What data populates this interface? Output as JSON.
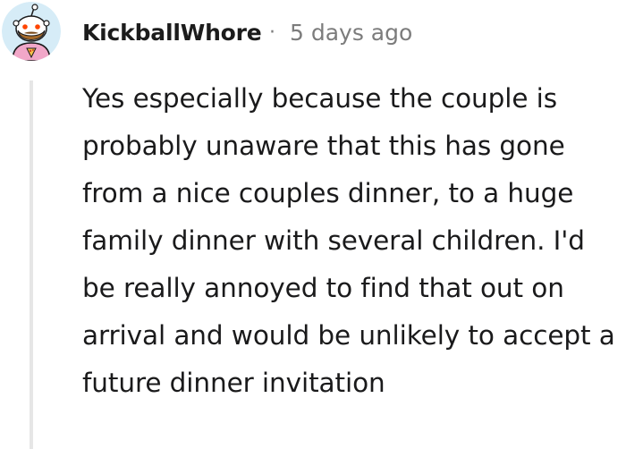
{
  "comment": {
    "avatar_icon": "snoo-avatar-icon",
    "username": "KickballWhore",
    "separator": "·",
    "timestamp": "5 days ago",
    "body": "Yes especially because the couple is probably unaware that this has gone from a nice couples dinner, to a huge family dinner with several children. I'd be really annoyed to find that out on arrival and would be unlikely to accept a future dinner invitation"
  },
  "colors": {
    "username": "#1c1c1c",
    "meta": "#7c7c7c",
    "body": "#1a1a1b",
    "thread_line": "#e6e6e6",
    "avatar_bg": "#d6ecf7",
    "avatar_shirt": "#f1a7c8"
  }
}
